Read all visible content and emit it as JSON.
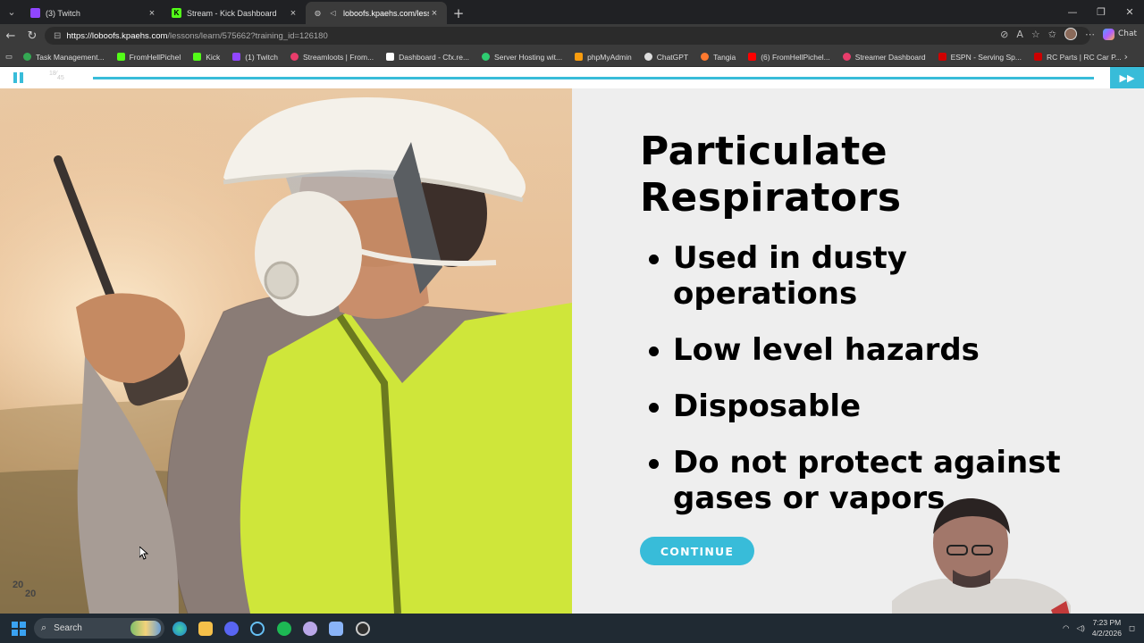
{
  "browser": {
    "tabs": [
      {
        "title": "(3) Twitch",
        "favicon_color": "#9146ff",
        "active": false
      },
      {
        "title": "Stream - Kick Dashboard",
        "favicon_color": "#53fc18",
        "favicon_letter": "K",
        "active": false
      },
      {
        "title": "loboofs.kpaehs.com/lessons/l",
        "favicon_color": "#888888",
        "active": true
      }
    ],
    "new_tab": "+",
    "url_host": "https://loboofs.kpaehs.com",
    "url_path": "/lessons/learn/575662?training_id=126180",
    "chat_label": "Chat"
  },
  "bookmarks": [
    {
      "label": "Task Management...",
      "color": "#34a853"
    },
    {
      "label": "FromHellPichel",
      "color": "#53fc18"
    },
    {
      "label": "Kick",
      "color": "#53fc18"
    },
    {
      "label": "(1) Twitch",
      "color": "#9146ff"
    },
    {
      "label": "Streamloots | From...",
      "color": "#e83d6b"
    },
    {
      "label": "Dashboard - Cfx.re...",
      "color": "#ffffff"
    },
    {
      "label": "Server Hosting wit...",
      "color": "#2ecc71"
    },
    {
      "label": "phpMyAdmin",
      "color": "#f89c0e"
    },
    {
      "label": "ChatGPT",
      "color": "#dddddd"
    },
    {
      "label": "Tangia",
      "color": "#ff7a2f"
    },
    {
      "label": "(6) FromHellPichel...",
      "color": "#ff0000"
    },
    {
      "label": "Streamer Dashboard",
      "color": "#e83d6b"
    },
    {
      "label": "ESPN - Serving Sp...",
      "color": "#d00000"
    },
    {
      "label": "RC Parts | RC Car P...",
      "color": "#cc0000"
    }
  ],
  "player": {
    "slide_current": "18",
    "slide_total": "45",
    "progress": 1.0,
    "accent": "#38bcd9"
  },
  "slide": {
    "title_line1": "Particulate",
    "title_line2": "Respirators",
    "bullets": [
      {
        "line1": "Used in dusty",
        "line2": "operations"
      },
      {
        "line1": "Low level hazards",
        "line2": ""
      },
      {
        "line1": "Disposable",
        "line2": ""
      },
      {
        "line1": "Do not protect against",
        "line2": "gases or vapors"
      }
    ],
    "continue_label": "CONTINUE",
    "logo_top": "20",
    "logo_bottom": "20"
  },
  "taskbar": {
    "search_placeholder": "Search",
    "time": "7:23 PM",
    "date": "4/2/2026"
  }
}
